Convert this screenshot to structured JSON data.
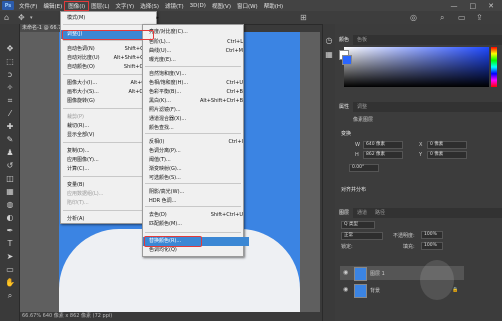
{
  "menubar": {
    "logo": "Ps",
    "items": [
      "文件(F)",
      "编辑(E)",
      "图像(I)",
      "图层(L)",
      "文字(Y)",
      "选择(S)",
      "滤镜(T)",
      "3D(D)",
      "视图(V)",
      "窗口(W)",
      "帮助(H)"
    ],
    "active_index": 2,
    "window_buttons": [
      "—",
      "□",
      "✕"
    ]
  },
  "document": {
    "tab_title": "未命名-1 @ 66.7%(图层 1, RGB/8)",
    "status": "66.67%   640 像素 x 862 像素 (72 ppi)"
  },
  "image_menu": {
    "items": [
      {
        "label": "模式(M)",
        "shortcut": "",
        "submenu": true
      },
      {
        "label": "调整(J)",
        "shortcut": "",
        "submenu": true
      },
      {
        "label": "自动色调(N)",
        "shortcut": "Shift+Ctrl+L"
      },
      {
        "label": "自动对比度(U)",
        "shortcut": "Alt+Shift+Ctrl+L"
      },
      {
        "label": "自动颜色(O)",
        "shortcut": "Shift+Ctrl+B"
      },
      {
        "label": "图像大小(I)...",
        "shortcut": "Alt+Ctrl+I"
      },
      {
        "label": "画布大小(S)...",
        "shortcut": "Alt+Ctrl+C"
      },
      {
        "label": "图像旋转(G)",
        "shortcut": "",
        "submenu": true
      },
      {
        "label": "裁剪(P)",
        "shortcut": "",
        "disabled": true
      },
      {
        "label": "裁切(R)...",
        "shortcut": ""
      },
      {
        "label": "显示全部(V)",
        "shortcut": ""
      },
      {
        "label": "复制(D)...",
        "shortcut": ""
      },
      {
        "label": "应用图像(Y)...",
        "shortcut": ""
      },
      {
        "label": "计算(C)...",
        "shortcut": ""
      },
      {
        "label": "变量(B)",
        "shortcut": "",
        "submenu": true
      },
      {
        "label": "应用数据组(L)...",
        "shortcut": "",
        "disabled": true
      },
      {
        "label": "陷印(T)...",
        "shortcut": "",
        "disabled": true
      },
      {
        "label": "分析(A)",
        "shortcut": "",
        "submenu": true
      }
    ]
  },
  "adjust_menu": {
    "items": [
      {
        "label": "亮度/对比度(C)...",
        "shortcut": ""
      },
      {
        "label": "色阶(L)...",
        "shortcut": "Ctrl+L"
      },
      {
        "label": "曲线(U)...",
        "shortcut": "Ctrl+M"
      },
      {
        "label": "曝光度(E)...",
        "shortcut": ""
      },
      {
        "label": "自然饱和度(V)...",
        "shortcut": ""
      },
      {
        "label": "色相/饱和度(H)...",
        "shortcut": "Ctrl+U"
      },
      {
        "label": "色彩平衡(B)...",
        "shortcut": "Ctrl+B"
      },
      {
        "label": "黑白(K)...",
        "shortcut": "Alt+Shift+Ctrl+B"
      },
      {
        "label": "照片滤镜(F)...",
        "shortcut": ""
      },
      {
        "label": "通道混合器(X)...",
        "shortcut": ""
      },
      {
        "label": "颜色查找...",
        "shortcut": ""
      },
      {
        "label": "反相(I)",
        "shortcut": "Ctrl+I"
      },
      {
        "label": "色调分离(P)...",
        "shortcut": ""
      },
      {
        "label": "阈值(T)...",
        "shortcut": ""
      },
      {
        "label": "渐变映射(G)...",
        "shortcut": ""
      },
      {
        "label": "可选颜色(S)...",
        "shortcut": ""
      },
      {
        "label": "阴影/高光(W)...",
        "shortcut": ""
      },
      {
        "label": "HDR 色调...",
        "shortcut": ""
      },
      {
        "label": "去色(D)",
        "shortcut": "Shift+Ctrl+U"
      },
      {
        "label": "匹配颜色(M)...",
        "shortcut": ""
      },
      {
        "label": "替换颜色(R)...",
        "shortcut": ""
      },
      {
        "label": "色调均化(Q)",
        "shortcut": ""
      }
    ],
    "highlighted_index": 20
  },
  "panels": {
    "color_tabs": [
      "颜色",
      "色板"
    ],
    "properties_tabs": [
      "属性",
      "调整"
    ],
    "properties_title": "像素图层",
    "transform_title": "变换",
    "w_label": "W",
    "w_value": "640 像素",
    "h_label": "H",
    "h_value": "862 像素",
    "x_label": "X",
    "x_value": "0 像素",
    "y_label": "Y",
    "y_value": "0 像素",
    "angle_value": "0.00°",
    "align_title": "对齐并分布",
    "layers_tabs": [
      "图层",
      "通道",
      "路径"
    ],
    "filter_kind": "Q 类型",
    "blend_mode": "正常",
    "opacity_label": "不透明度:",
    "opacity_value": "100%",
    "lock_label": "锁定:",
    "fill_label": "填充:",
    "fill_value": "100%",
    "layers": [
      {
        "name": "图层 1",
        "selected": true
      },
      {
        "name": "背景",
        "selected": false
      }
    ]
  },
  "colors": {
    "highlight": "#3b87d4",
    "callout": "#e23a3a",
    "photo_bg": "#3b84e3"
  }
}
